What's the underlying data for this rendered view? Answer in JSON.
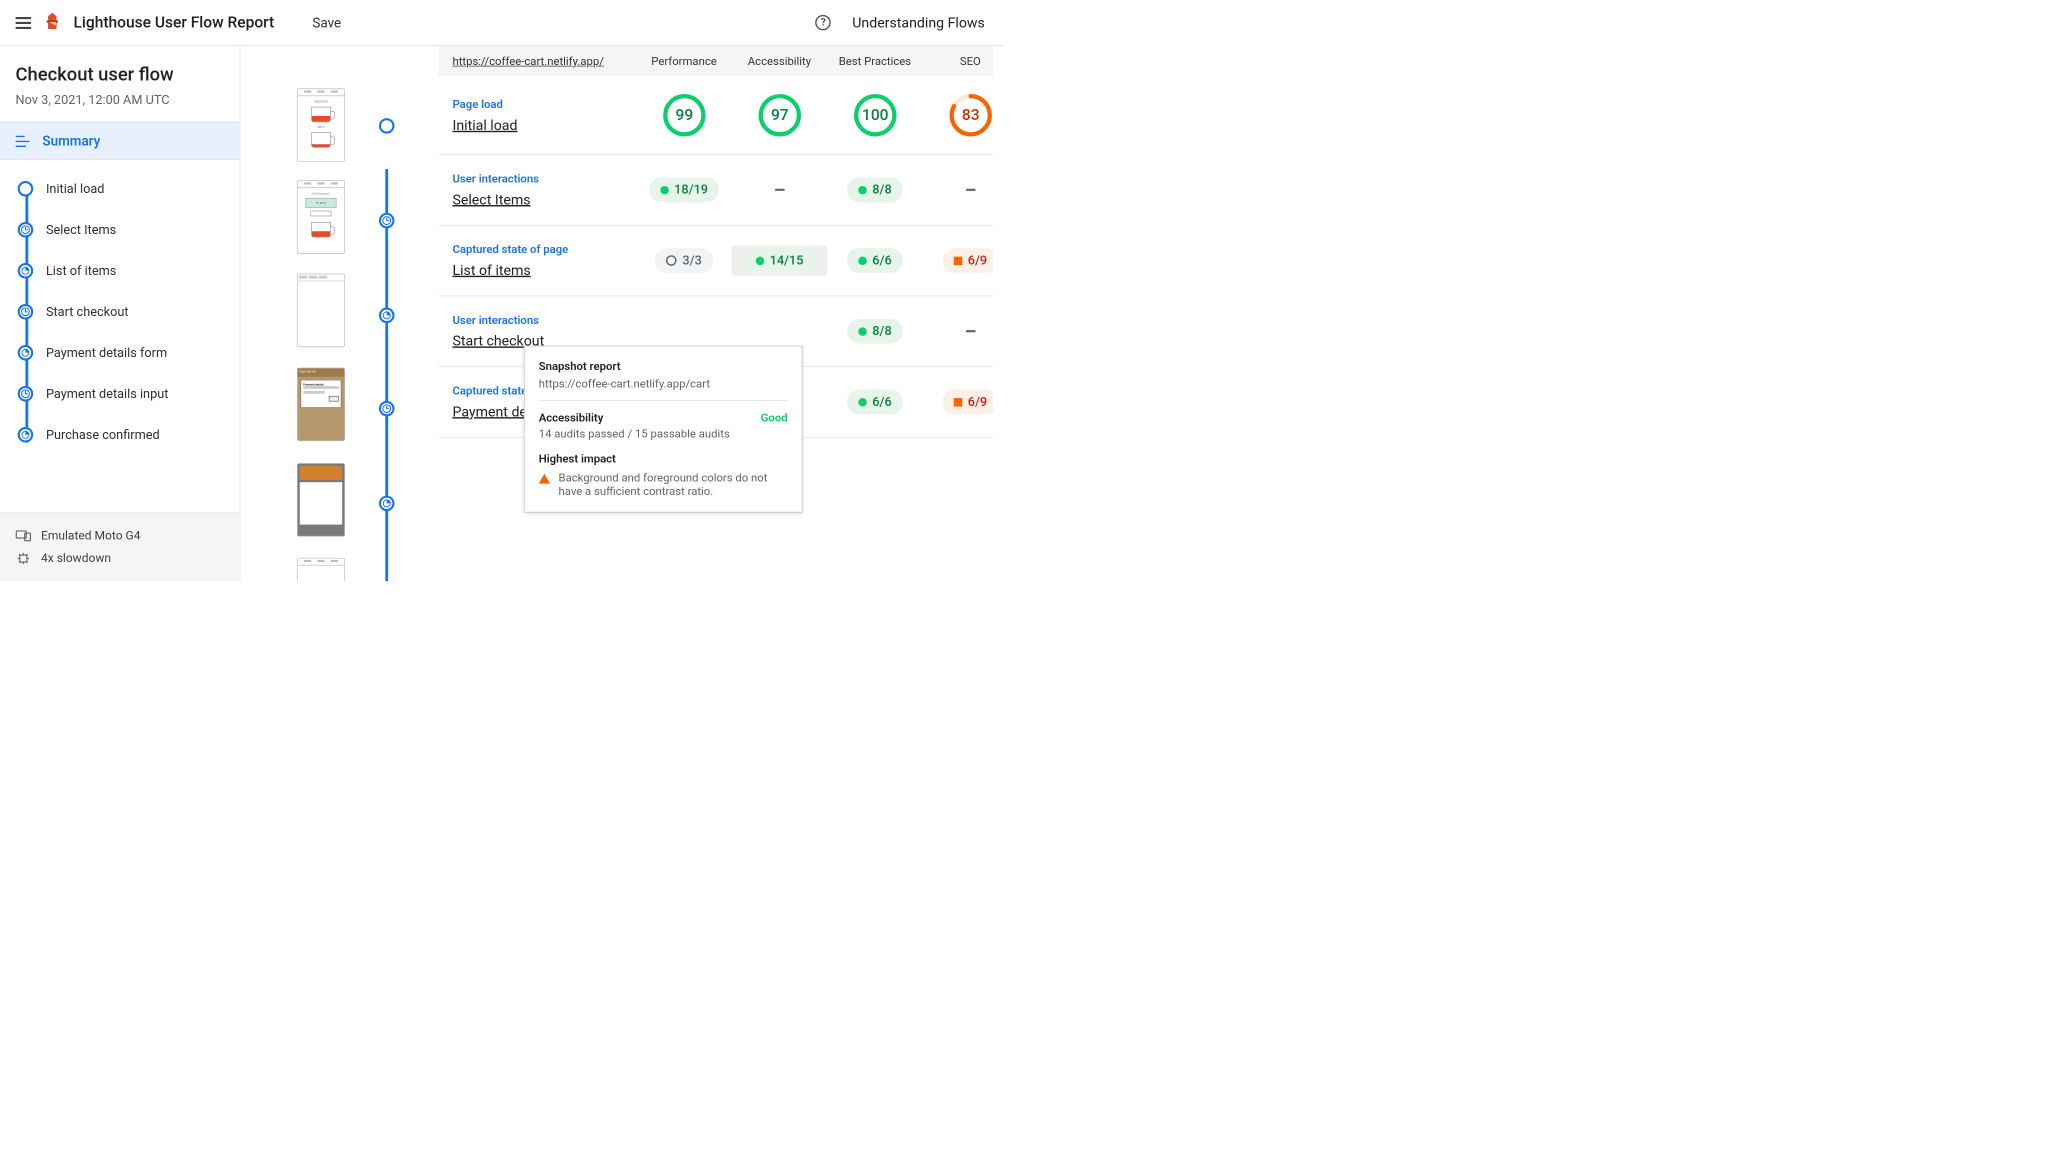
{
  "header": {
    "title": "Lighthouse User Flow Report",
    "save": "Save",
    "flows_link": "Understanding Flows"
  },
  "sidebar": {
    "flow_name": "Checkout user flow",
    "datetime": "Nov 3, 2021, 12:00 AM UTC",
    "summary_label": "Summary",
    "steps": [
      {
        "type": "navigation",
        "label": "Initial load"
      },
      {
        "type": "timespan",
        "label": "Select Items"
      },
      {
        "type": "snapshot",
        "label": "List of items"
      },
      {
        "type": "timespan",
        "label": "Start checkout"
      },
      {
        "type": "snapshot",
        "label": "Payment details form"
      },
      {
        "type": "timespan",
        "label": "Payment details input"
      },
      {
        "type": "snapshot",
        "label": "Purchase confirmed"
      }
    ],
    "env": {
      "device": "Emulated Moto G4",
      "throttle": "4x slowdown"
    }
  },
  "table": {
    "url": "https://coffee-cart.netlify.app/",
    "columns": [
      "Performance",
      "Accessibility",
      "Best Practices",
      "SEO"
    ],
    "rows": [
      {
        "kind_label": "Page load",
        "title": "Initial load",
        "cells": [
          {
            "type": "gauge",
            "value": 99,
            "tone": "green"
          },
          {
            "type": "gauge",
            "value": 97,
            "tone": "green"
          },
          {
            "type": "gauge",
            "value": 100,
            "tone": "green"
          },
          {
            "type": "gauge",
            "value": 83,
            "tone": "orange"
          }
        ]
      },
      {
        "kind_label": "User interactions",
        "title": "Select Items",
        "cells": [
          {
            "type": "pill",
            "text": "18/19",
            "tone": "green"
          },
          {
            "type": "dash"
          },
          {
            "type": "pill",
            "text": "8/8",
            "tone": "green"
          },
          {
            "type": "dash"
          }
        ]
      },
      {
        "kind_label": "Captured state of page",
        "title": "List of items",
        "cells": [
          {
            "type": "pill",
            "text": "3/3",
            "tone": "grey"
          },
          {
            "type": "pill",
            "text": "14/15",
            "tone": "green",
            "highlight": true
          },
          {
            "type": "pill",
            "text": "6/6",
            "tone": "green"
          },
          {
            "type": "pill",
            "text": "6/9",
            "tone": "orange"
          }
        ]
      },
      {
        "kind_label": "User interactions",
        "title": "Start checkout",
        "truncated": true,
        "cells": [
          {
            "type": "hidden"
          },
          {
            "type": "hidden"
          },
          {
            "type": "pill",
            "text": "8/8",
            "tone": "green"
          },
          {
            "type": "dash"
          }
        ]
      },
      {
        "kind_label": "Captured state of page",
        "title": "Payment details form",
        "truncated": true,
        "truncated_kind": "Captured state",
        "truncated_title": "Payment det",
        "cells": [
          {
            "type": "hidden"
          },
          {
            "type": "hidden"
          },
          {
            "type": "pill",
            "text": "6/6",
            "tone": "green"
          },
          {
            "type": "pill",
            "text": "6/9",
            "tone": "orange"
          }
        ]
      }
    ]
  },
  "tooltip": {
    "title": "Snapshot report",
    "url": "https://coffee-cart.netlify.app/cart",
    "category": "Accessibility",
    "rating": "Good",
    "detail": "14 audits passed / 15 passable audits",
    "hi_title": "Highest impact",
    "hi_text": "Background and foreground colors do not have a sufficient contrast ratio."
  }
}
